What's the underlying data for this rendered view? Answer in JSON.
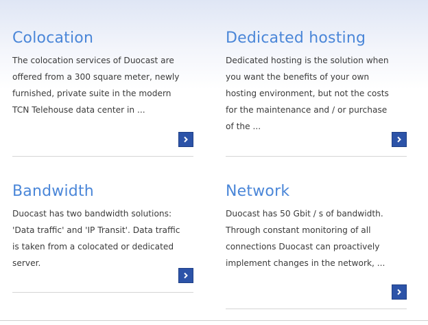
{
  "services": [
    {
      "title": "Colocation",
      "description": "The colocation services of Duocast are offered from a 300 square meter, newly furnished, private suite in the modern TCN Telehouse data center in ...",
      "more_icon": "arrow-right-icon"
    },
    {
      "title": "Dedicated hosting",
      "description": "Dedicated hosting is the solution when you want the benefits of your own hosting environment, but not the costs for the maintenance and / or purchase of the ...",
      "more_icon": "arrow-right-icon"
    },
    {
      "title": "Bandwidth",
      "description": "Duocast has two bandwidth solutions: 'Data traffic' and 'IP Transit'. Data traffic is taken from a colocated or dedicated server.",
      "more_icon": "arrow-right-icon"
    },
    {
      "title": "Network",
      "description": "Duocast has 50 Gbit / s of bandwidth. Through constant monitoring of all connections Duocast can proactively implement changes in the network, ...",
      "more_icon": "arrow-right-icon"
    }
  ],
  "colors": {
    "title": "#4a86d8",
    "button": "#2c53a8",
    "text": "#3a3a3a"
  }
}
